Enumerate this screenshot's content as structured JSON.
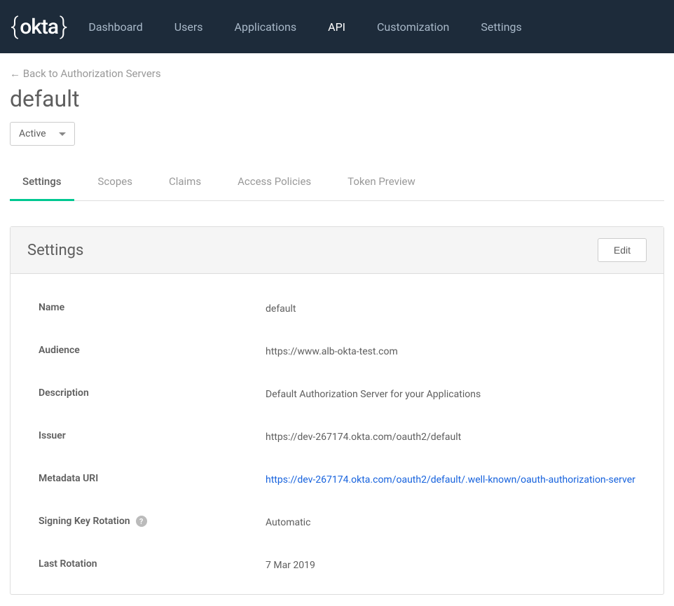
{
  "brand": "okta",
  "nav": {
    "items": [
      {
        "label": "Dashboard",
        "active": false
      },
      {
        "label": "Users",
        "active": false
      },
      {
        "label": "Applications",
        "active": false
      },
      {
        "label": "API",
        "active": true
      },
      {
        "label": "Customization",
        "active": false
      },
      {
        "label": "Settings",
        "active": false
      }
    ]
  },
  "breadcrumb": "← Back to Authorization Servers",
  "page_title": "default",
  "status_dropdown": "Active",
  "tabs": [
    {
      "label": "Settings",
      "active": true
    },
    {
      "label": "Scopes",
      "active": false
    },
    {
      "label": "Claims",
      "active": false
    },
    {
      "label": "Access Policies",
      "active": false
    },
    {
      "label": "Token Preview",
      "active": false
    }
  ],
  "panel": {
    "title": "Settings",
    "edit_label": "Edit",
    "fields": {
      "name": {
        "label": "Name",
        "value": "default"
      },
      "audience": {
        "label": "Audience",
        "value": "https://www.alb-okta-test.com"
      },
      "description": {
        "label": "Description",
        "value": "Default Authorization Server for your Applications"
      },
      "issuer": {
        "label": "Issuer",
        "value": "https://dev-267174.okta.com/oauth2/default"
      },
      "metadata_uri": {
        "label": "Metadata URI",
        "value": "https://dev-267174.okta.com/oauth2/default/.well-known/oauth-authorization-server"
      },
      "signing_key_rotation": {
        "label": "Signing Key Rotation",
        "value": "Automatic"
      },
      "last_rotation": {
        "label": "Last Rotation",
        "value": "7 Mar 2019"
      }
    }
  }
}
